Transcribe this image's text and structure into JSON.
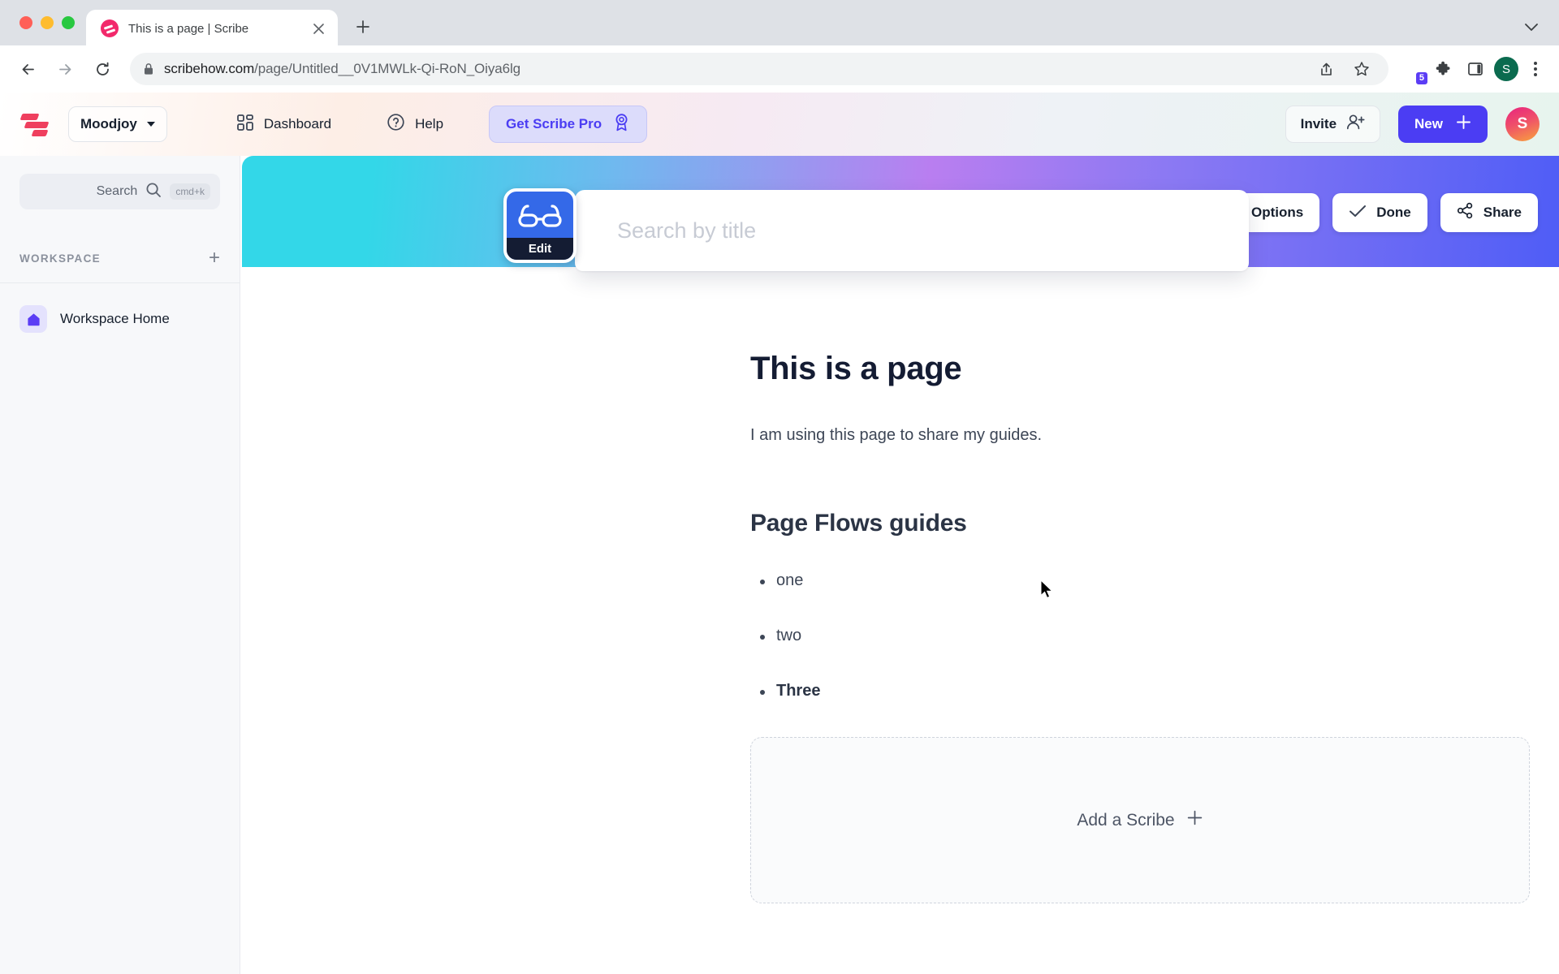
{
  "browser": {
    "tab": {
      "title": "This is a page | Scribe",
      "favicon": "scribe-favicon",
      "close_icon": "close-icon"
    },
    "new_tab_icon": "plus-icon",
    "tab_list_icon": "chevron-down-icon",
    "nav": {
      "back_icon": "back-arrow-icon",
      "forward_icon": "forward-arrow-icon",
      "reload_icon": "reload-icon"
    },
    "omnibox": {
      "lock_icon": "lock-icon",
      "url_host": "scribehow.com",
      "url_path": "/page/Untitled__0V1MWLk-Qi-RoN_Oiya6lg"
    },
    "actions": {
      "share_icon": "share-icon",
      "bookmark_icon": "star-icon",
      "extension_scribe_icon": "scribe-extension-icon",
      "extension_scribe_badge": "5",
      "extensions_icon": "puzzle-icon",
      "sidepanel_icon": "side-panel-icon",
      "profile_initial": "S",
      "menu_icon": "kebab-menu-icon"
    }
  },
  "app_header": {
    "logo": "scribe-logo",
    "workspace_name": "Moodjoy",
    "workspace_caret": "chevron-down-icon",
    "dashboard_label": "Dashboard",
    "dashboard_icon": "grid-icon",
    "help_label": "Help",
    "help_icon": "question-circle-icon",
    "pro_label": "Get Scribe Pro",
    "pro_icon": "ribbon-badge-icon",
    "invite_label": "Invite",
    "invite_icon": "person-plus-icon",
    "new_label": "New",
    "new_icon": "plus-icon",
    "avatar_initial": "S"
  },
  "sidebar": {
    "search_label": "Search",
    "search_icon": "search-icon",
    "search_shortcut": "cmd+k",
    "section_label": "WORKSPACE",
    "add_icon": "plus-icon",
    "items": [
      {
        "label": "Workspace Home",
        "icon": "home-icon"
      }
    ]
  },
  "banner": {
    "options_label": "Options",
    "options_icon": "sliders-icon",
    "done_label": "Done",
    "done_icon": "check-icon",
    "share_label": "Share",
    "share_icon": "share-nodes-icon",
    "gradient_from": "#33d7e8",
    "gradient_mid": "#b97ef0",
    "gradient_to": "#4f5df6"
  },
  "edit_chip": {
    "label": "Edit",
    "icon": "glasses-icon",
    "bg_color": "#3469e8"
  },
  "title_search": {
    "placeholder": "Search by title",
    "value": ""
  },
  "document": {
    "heading": "This is a page",
    "paragraph": "I am using this page to share my guides.",
    "subheading": "Page Flows guides",
    "bullets": [
      {
        "text": "one",
        "bold": false
      },
      {
        "text": "two",
        "bold": false
      },
      {
        "text": "Three",
        "bold": true
      }
    ],
    "add_scribe_label": "Add a Scribe",
    "add_scribe_icon": "plus-icon"
  }
}
